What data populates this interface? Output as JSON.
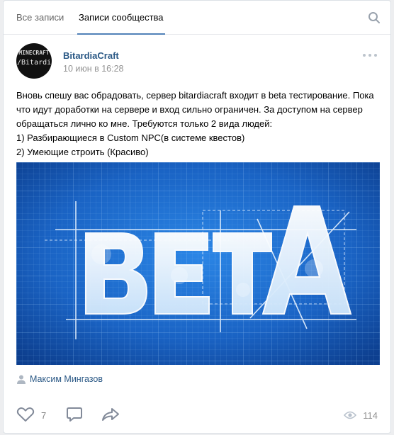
{
  "tabs": {
    "all_posts": "Все записи",
    "community_posts": "Записи сообщества"
  },
  "icons": {
    "search": "search-icon",
    "more": "more-dots-icon",
    "like": "heart-icon",
    "comment": "comment-icon",
    "share": "share-icon",
    "views": "eye-icon",
    "signer": "user-icon"
  },
  "post": {
    "author": "BitardiaCraft",
    "date": "10 июн в 16:28",
    "avatar_text_top": "MINECRAFT",
    "avatar_text_bottom": "/Bitardia",
    "paragraph": "Вновь спешу вас обрадовать, сервер bitardiacraft входит в beta тестирование. Пока что идут доработки на сервере и вход сильно ограничен. За доступом на сервер обращаться лично ко мне. Требуются только 2 вида людей:",
    "line1": "1) Разбирающиеся в Custom NPC(в системе квестов)",
    "line2": "2) Умеющие строить (Красиво)",
    "image_word": "BETA",
    "signer": "Максим Мингазов",
    "likes": "7",
    "views": "114"
  },
  "colors": {
    "link": "#2a5885",
    "muted": "#939393",
    "tab_underline": "#5181b8",
    "blueprint_bg": "#1a63c4"
  }
}
